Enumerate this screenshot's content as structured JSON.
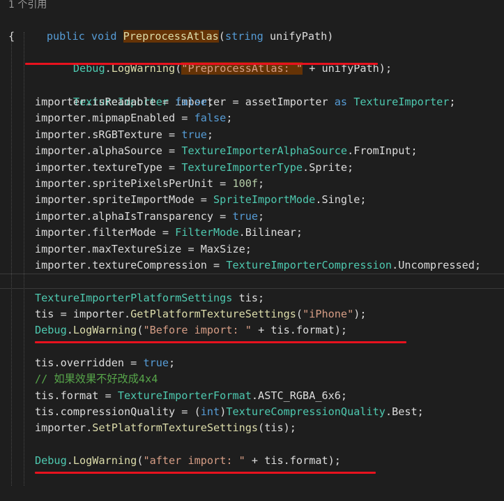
{
  "codelens": "1 个引用",
  "signature": {
    "public": "public",
    "void": "void",
    "name": "PreprocessAtlas",
    "open": "(",
    "ptype": "string",
    "pname": "unifyPath",
    "close": ")"
  },
  "brace_open": "{",
  "log1": {
    "cls": "Debug",
    "dot": ".",
    "method": "LogWarning",
    "open": "(",
    "str": "\"PreprocessAtlas: \"",
    "rest": " + unifyPath);"
  },
  "importer_decl": {
    "type1": "TextureImporter",
    "mid": " importer = assetImporter ",
    "as": "as",
    "sp": " ",
    "type2": "TextureImporter",
    "end": ";"
  },
  "assignments": [
    {
      "prefix": "importer.isReadable = ",
      "value": "false",
      "vclass": "kw",
      "suffix": ";"
    },
    {
      "prefix": "importer.mipmapEnabled = ",
      "value": "false",
      "vclass": "kw",
      "suffix": ";"
    },
    {
      "prefix": "importer.sRGBTexture = ",
      "value": "true",
      "vclass": "kw",
      "suffix": ";"
    },
    {
      "prefix": "importer.alphaSource = ",
      "value": "TextureImporterAlphaSource",
      "vclass": "ty",
      "suffix": ".FromInput;"
    },
    {
      "prefix": "importer.textureType = ",
      "value": "TextureImporterType",
      "vclass": "ty",
      "suffix": ".Sprite;"
    },
    {
      "prefix": "importer.spritePixelsPerUnit = ",
      "value": "100f",
      "vclass": "num",
      "suffix": ";"
    },
    {
      "prefix": "importer.spriteImportMode = ",
      "value": "SpriteImportMode",
      "vclass": "ty",
      "suffix": ".Single;"
    },
    {
      "prefix": "importer.alphaIsTransparency = ",
      "value": "true",
      "vclass": "kw",
      "suffix": ";"
    },
    {
      "prefix": "importer.filterMode = ",
      "value": "FilterMode",
      "vclass": "ty",
      "suffix": ".Bilinear;"
    },
    {
      "prefix": "importer.maxTextureSize = ",
      "value": "MaxSize",
      "vclass": "id",
      "suffix": ";"
    },
    {
      "prefix": "importer.textureCompression = ",
      "value": "TextureImporterCompression",
      "vclass": "ty",
      "suffix": ".Uncompressed;"
    }
  ],
  "tis_decl": {
    "type": "TextureImporterPlatformSettings",
    "rest": " tis;"
  },
  "tis_get": {
    "prefix": "tis = importer.",
    "method": "GetPlatformTextureSettings",
    "open": "(",
    "str": "\"iPhone\"",
    "end": ");"
  },
  "log2": {
    "cls": "Debug",
    "dot": ".",
    "method": "LogWarning",
    "open": "(",
    "str": "\"Before import: \"",
    "rest": " + tis.format);"
  },
  "overridden": {
    "prefix": "tis.overridden = ",
    "value": "true",
    "suffix": ";"
  },
  "comment": "// 如果效果不好改成4x4",
  "format_line": {
    "prefix": "tis.format = ",
    "type": "TextureImporterFormat",
    "suffix": ".ASTC_RGBA_6x6;"
  },
  "quality_line": {
    "prefix": "tis.compressionQuality = (",
    "kw": "int",
    "mid": ")",
    "type": "TextureCompressionQuality",
    "suffix": ".Best;"
  },
  "set_line": {
    "prefix": "importer.",
    "method": "SetPlatformTextureSettings",
    "suffix": "(tis);"
  },
  "log3": {
    "cls": "Debug",
    "dot": ".",
    "method": "LogWarning",
    "open": "(",
    "str": "\"after import: \"",
    "rest": " + tis.format);"
  },
  "colors": {
    "background": "#1e1e1e",
    "keyword": "#569cd6",
    "type": "#4ec9b0",
    "method": "#dcdcaa",
    "string": "#d69d85",
    "comment": "#57a64a",
    "highlight": "#653306",
    "underline_annotation": "#e8121e"
  }
}
